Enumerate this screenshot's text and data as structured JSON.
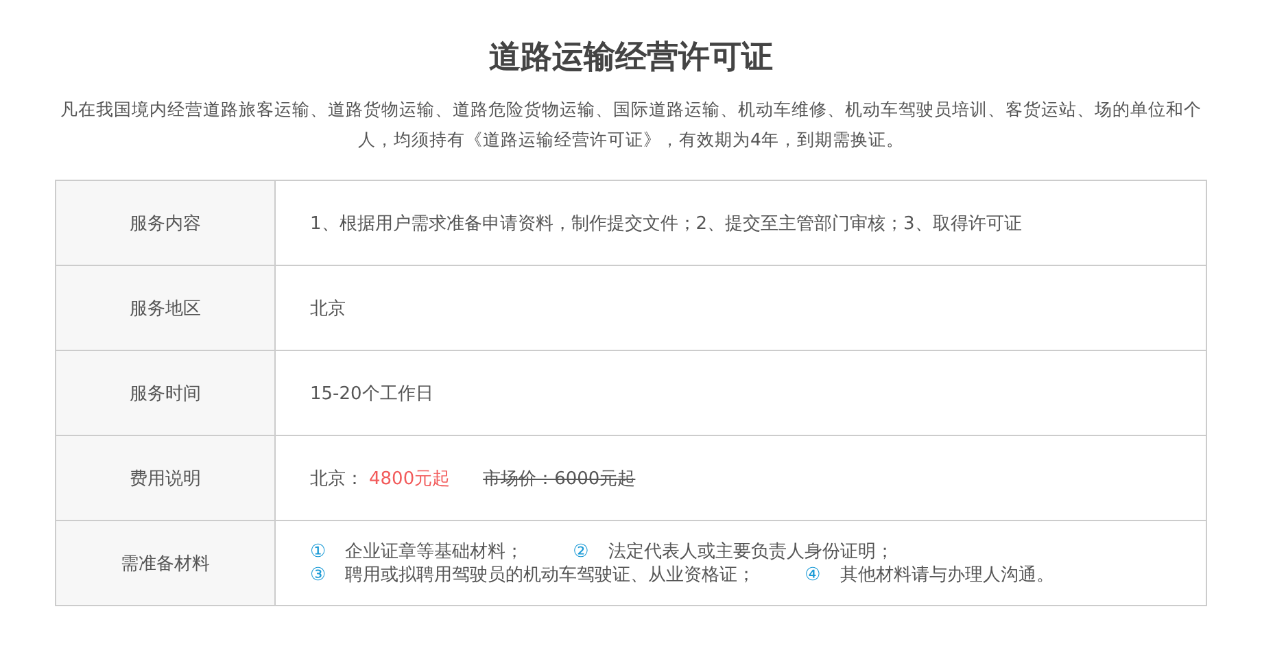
{
  "title": "道路运输经营许可证",
  "description": "凡在我国境内经营道路旅客运输、道路货物运输、道路危险货物运输、国际道路运输、机动车维修、机动车驾驶员培训、客货运站、场的单位和个人，均须持有《道路运输经营许可证》，有效期为4年，到期需换证。",
  "table": {
    "rows": [
      {
        "label": "服务内容",
        "kind": "text",
        "text": "1、根据用户需求准备申请资料，制作提交文件；2、提交至主管部门审核；3、取得许可证"
      },
      {
        "label": "服务地区",
        "kind": "text",
        "text": "北京"
      },
      {
        "label": "服务时间",
        "kind": "text",
        "text": "15-20个工作日"
      },
      {
        "label": "费用说明",
        "kind": "price",
        "region": "北京：",
        "price": "4800元起",
        "market_price": "市场价：6000元起"
      },
      {
        "label": "需准备材料",
        "kind": "materials",
        "lines": [
          [
            {
              "number": "①",
              "text": "企业证章等基础材料；"
            },
            {
              "number": "②",
              "text": "法定代表人或主要负责人身份证明；"
            }
          ],
          [
            {
              "number": "③",
              "text": "聘用或拟聘用驾驶员的机动车驾驶证、从业资格证；"
            },
            {
              "number": "④",
              "text": "其他材料请与办理人沟通。"
            }
          ]
        ]
      }
    ]
  }
}
